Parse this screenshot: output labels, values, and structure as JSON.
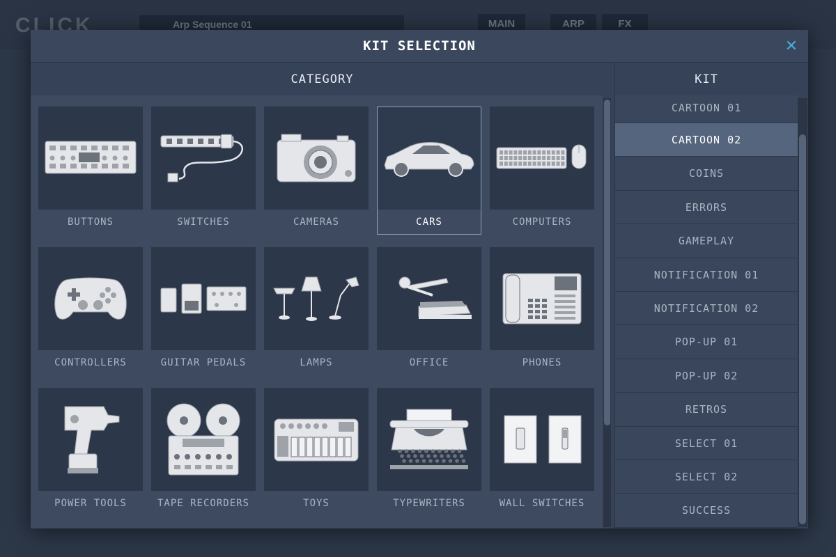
{
  "background": {
    "logo": "CLICK",
    "sequence_name": "Arp Sequence 01",
    "tabs": [
      "MAIN",
      "ARP",
      "FX"
    ]
  },
  "modal": {
    "title": "KIT SELECTION",
    "close_glyph": "✕"
  },
  "category": {
    "header": "CATEGORY",
    "items": [
      {
        "label": "BUTTONS",
        "icon": "button-panel-icon"
      },
      {
        "label": "SWITCHES",
        "icon": "power-strip-icon"
      },
      {
        "label": "CAMERAS",
        "icon": "camera-icon"
      },
      {
        "label": "CARS",
        "icon": "car-icon",
        "selected": true
      },
      {
        "label": "COMPUTERS",
        "icon": "keyboard-mouse-icon"
      },
      {
        "label": "CONTROLLERS",
        "icon": "gamepad-icon"
      },
      {
        "label": "GUITAR PEDALS",
        "icon": "guitar-pedal-icon"
      },
      {
        "label": "LAMPS",
        "icon": "lamp-icon"
      },
      {
        "label": "OFFICE",
        "icon": "stapler-icon"
      },
      {
        "label": "PHONES",
        "icon": "phone-icon"
      },
      {
        "label": "POWER TOOLS",
        "icon": "drill-icon"
      },
      {
        "label": "TAPE RECORDERS",
        "icon": "tape-recorder-icon"
      },
      {
        "label": "TOYS",
        "icon": "toy-keyboard-icon"
      },
      {
        "label": "TYPEWRITERS",
        "icon": "typewriter-icon"
      },
      {
        "label": "WALL SWITCHES",
        "icon": "wall-switch-icon"
      }
    ]
  },
  "kit": {
    "header": "KIT",
    "items": [
      {
        "label": "CARTOON 01"
      },
      {
        "label": "CARTOON 02",
        "selected": true
      },
      {
        "label": "COINS"
      },
      {
        "label": "ERRORS"
      },
      {
        "label": "GAMEPLAY"
      },
      {
        "label": "NOTIFICATION 01"
      },
      {
        "label": "NOTIFICATION 02"
      },
      {
        "label": "POP-UP 01"
      },
      {
        "label": "POP-UP 02"
      },
      {
        "label": "RETROS"
      },
      {
        "label": "SELECT 01"
      },
      {
        "label": "SELECT 02"
      },
      {
        "label": "SUCCESS"
      }
    ]
  }
}
